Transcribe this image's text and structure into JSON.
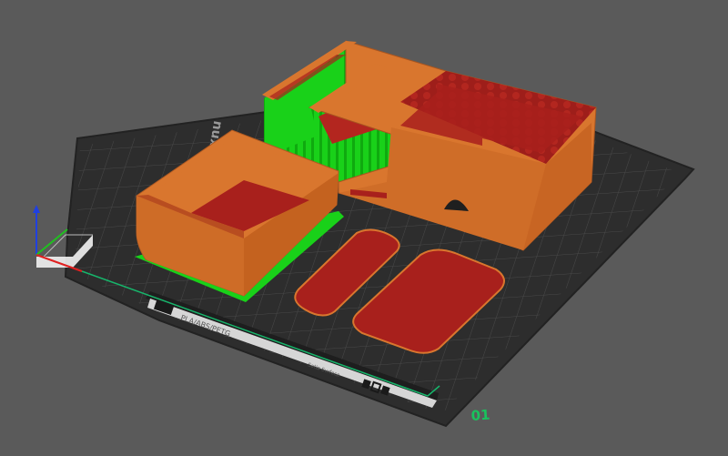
{
  "viewport": {
    "background": "#5a5a5a",
    "bed_color": "#2d2d2d",
    "grid_color": "#4a4a4a",
    "object_orange": "#d9762e",
    "object_red": "#a8201c",
    "support_green": "#19d119"
  },
  "bed": {
    "brand_text": "xnu",
    "sheet_label": "PLA/ABS/PETG",
    "sheet_surface_text": "Satin Surface",
    "corner_number": "01"
  },
  "axes": {
    "x_color": "#e02020",
    "y_color": "#20c020",
    "z_color": "#2040e0"
  }
}
